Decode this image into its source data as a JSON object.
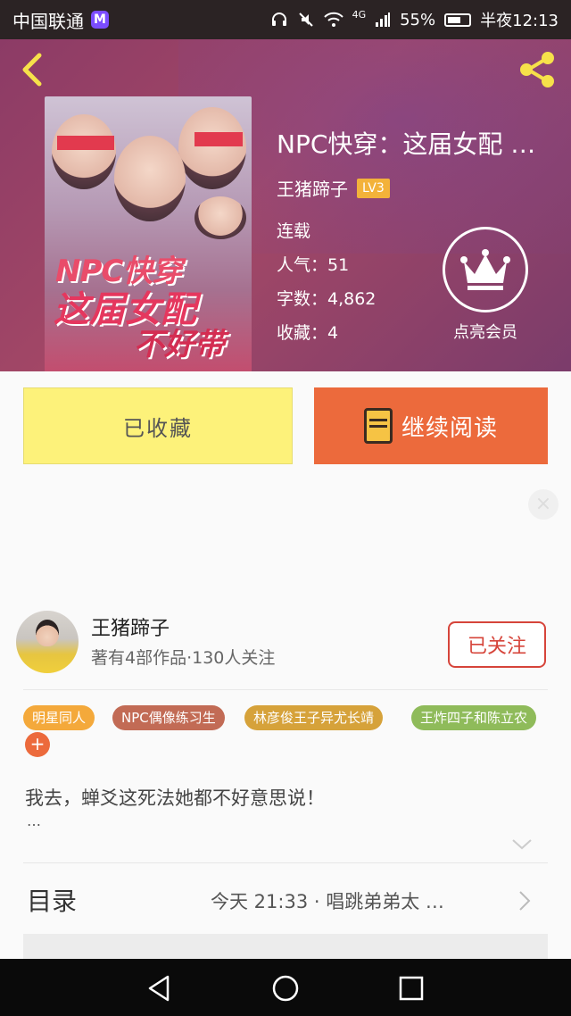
{
  "status_bar": {
    "carrier": "中国联通",
    "network": "4G",
    "battery": "55%",
    "time": "半夜12:13"
  },
  "book": {
    "title": "NPC快穿：这届女配 …",
    "author": "王猪蹄子",
    "level": "LV3",
    "status": "连载",
    "popularity": "人气：51",
    "word_count": "字数：4,862",
    "favorites": "收藏：4",
    "cover_text": {
      "line1": "NPC快穿",
      "line2": "这届女配",
      "line3": "不好带"
    }
  },
  "vip": {
    "label": "点亮会员"
  },
  "actions": {
    "collected_label": "已收藏",
    "continue_label": "继续阅读"
  },
  "author_card": {
    "name": "王猪蹄子",
    "stats": "著有4部作品·130人关注",
    "follow_label": "已关注"
  },
  "tags": [
    {
      "label": "明星同人",
      "color": "#f4a93b"
    },
    {
      "label": "NPC偶像练习生",
      "color": "#c26b55"
    },
    {
      "label": "林彦俊王子异尤长靖",
      "color": "#d6a23a"
    },
    {
      "label": "王炸四子和陈立农",
      "color": "#8fbb5a"
    }
  ],
  "description": {
    "text": "我去，蝉爻这死法她都不好意思说！",
    "ellipsis": "…"
  },
  "toc": {
    "label": "目录",
    "latest": "今天 21:33 · 唱跳弟弟太 …"
  }
}
